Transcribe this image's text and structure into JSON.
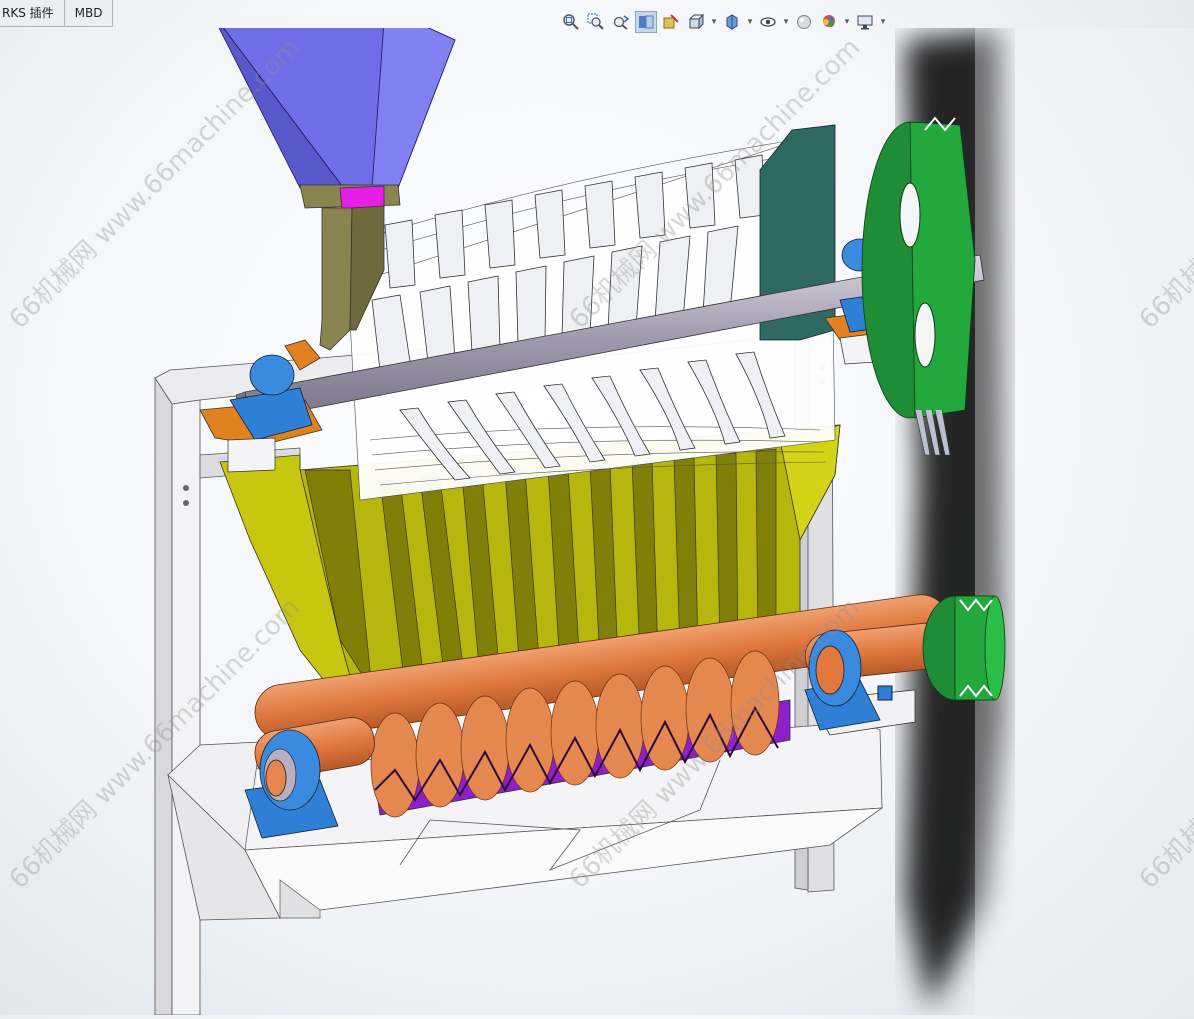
{
  "tabs": [
    {
      "label": "RKS 插件"
    },
    {
      "label": "MBD"
    }
  ],
  "toolbar": {
    "icons": [
      "zoom-to-fit-icon",
      "zoom-to-area-icon",
      "previous-view-icon",
      "section-view-icon",
      "dynamic-annotation-icon",
      "view-orientation-icon",
      "display-style-icon",
      "hide-show-items-icon",
      "edit-appearance-icon",
      "apply-scene-icon",
      "view-settings-icon"
    ]
  },
  "watermarks": [
    {
      "text": "66机械网 www.66machine.com"
    },
    {
      "text": "66机械网 www.66machine.com"
    },
    {
      "text": "66机械网 www.66machine.com"
    },
    {
      "text": "66机械网 www.66machine.com"
    },
    {
      "text": "66机械网"
    },
    {
      "text": "66机械网"
    }
  ],
  "colors": {
    "hopper": "#6f6ee6",
    "hopper_throat": "#e61ee6",
    "chute": "#8a8550",
    "trough": "#b8b812",
    "trough_dark": "#7e7e07",
    "drum_white": "#f4f5f7",
    "shaft_grey": "#9c97a8",
    "bearing_blue": "#2f7fd6",
    "bearing_orange": "#e2821e",
    "screw_orange": "#e2854e",
    "screw_purple": "#9a22d2",
    "pulley_green": "#22a83c",
    "end_plate": "#2f6a62",
    "frame_grey": "#e6e6e8"
  }
}
